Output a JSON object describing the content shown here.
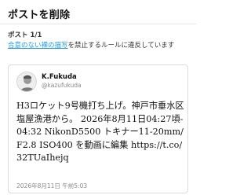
{
  "header": {
    "title": "ポストを削除"
  },
  "post_count": "ポスト 1/1",
  "reason": {
    "link_text": "合意のない裸の描写",
    "rest_text": "を禁止するルールに違反しています"
  },
  "tweet": {
    "display_name": "K.Fukuda",
    "handle": "@kazufukuda",
    "text": "H3ロケット9号機打ち上げ。神戸市垂水区塩屋漁港から。 2026年8月11日04:27頃-04:32 NikonD5500 トキナー11-20mm/F2.8 ISO400 を動画に編集 https://t.co/32TUaIhejq",
    "timestamp": "2026年8月11日 午前5:03"
  }
}
